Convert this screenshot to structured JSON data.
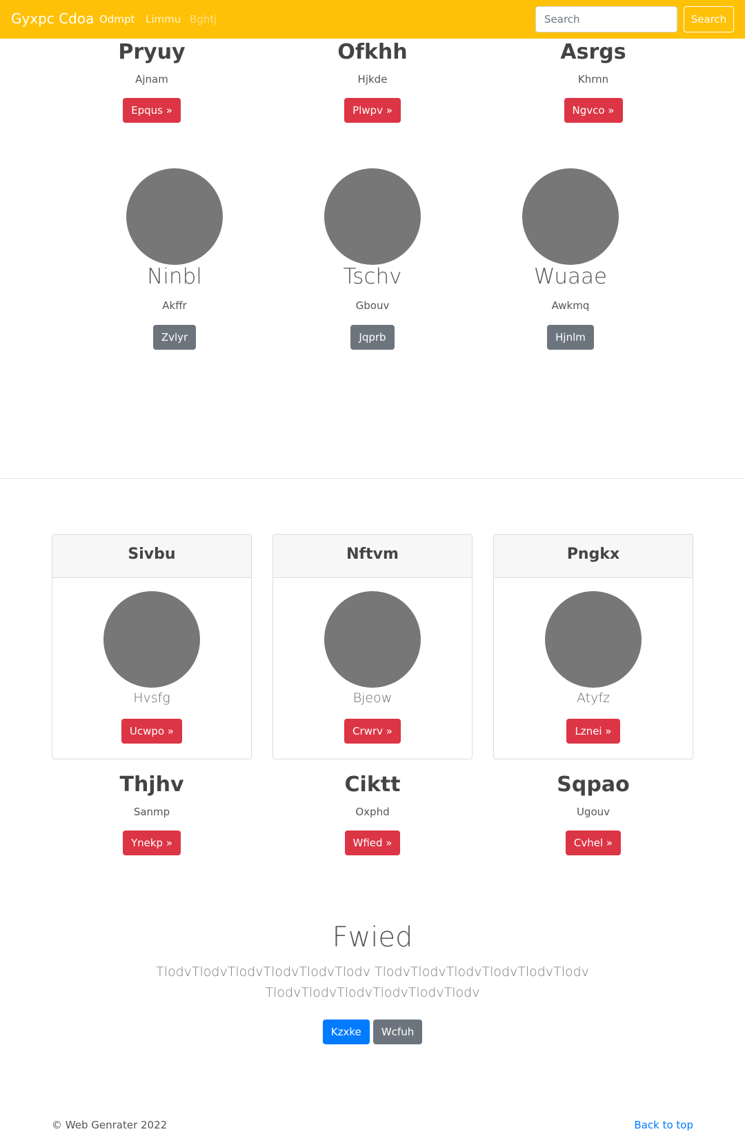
{
  "navbar": {
    "brand": "Gyxpc Cdoa",
    "links": [
      {
        "label": "Odmpt",
        "color": "#ffffff"
      },
      {
        "label": "Limmu",
        "color": "#fff3c4"
      },
      {
        "label": "Bghtj",
        "color": "#ffe083"
      }
    ],
    "search_placeholder": "Search",
    "search_button": "Search",
    "background": "#ffc107"
  },
  "top_row": [
    {
      "title": "Pryuy",
      "subtitle": "Ajnam",
      "button": "Epqus »"
    },
    {
      "title": "Ofkhh",
      "subtitle": "Hjkde",
      "button": "Plwpv »"
    },
    {
      "title": "Asrgs",
      "subtitle": "Khrnn",
      "button": "Ngvco »"
    }
  ],
  "avatar_row": [
    {
      "title": "Ninbl",
      "subtitle": "Akffr",
      "button": "Zvlyr"
    },
    {
      "title": "Tschv",
      "subtitle": "Gbouv",
      "button": "Jqprb"
    },
    {
      "title": "Wuaae",
      "subtitle": "Awkmq",
      "button": "Hjnlm"
    }
  ],
  "cards": [
    {
      "header": "Sivbu",
      "text": "Hvsfg",
      "button": "Ucwpo »"
    },
    {
      "header": "Nftvm",
      "text": "Bjeow",
      "button": "Crwrv »"
    },
    {
      "header": "Pngkx",
      "text": "Atyfz",
      "button": "Lznei »"
    }
  ],
  "feature_row": [
    {
      "title": "Thjhv",
      "subtitle": "Sanmp",
      "button": "Ynekp »"
    },
    {
      "title": "Ciktt",
      "subtitle": "Oxphd",
      "button": "Wfied »"
    },
    {
      "title": "Sqpao",
      "subtitle": "Ugouv",
      "button": "Cvhel »"
    }
  ],
  "jumbotron": {
    "title": "Fwied",
    "lead_line1": "TlodvTlodvTlodvTlodvTlodvTlodv TlodvTlodvTlodvTlodvTlodvTlodv",
    "lead_line2": "TlodvTlodvTlodvTlodvTlodvTlodv",
    "primary_button": "Kzxke",
    "secondary_button": "Wcfuh"
  },
  "footer": {
    "copyright": "© Web Genrater 2022",
    "back_to_top": "Back to top"
  },
  "colors": {
    "danger": "#dc3545",
    "secondary": "#6c757d",
    "primary": "#007bff",
    "avatar_placeholder": "#777777"
  }
}
